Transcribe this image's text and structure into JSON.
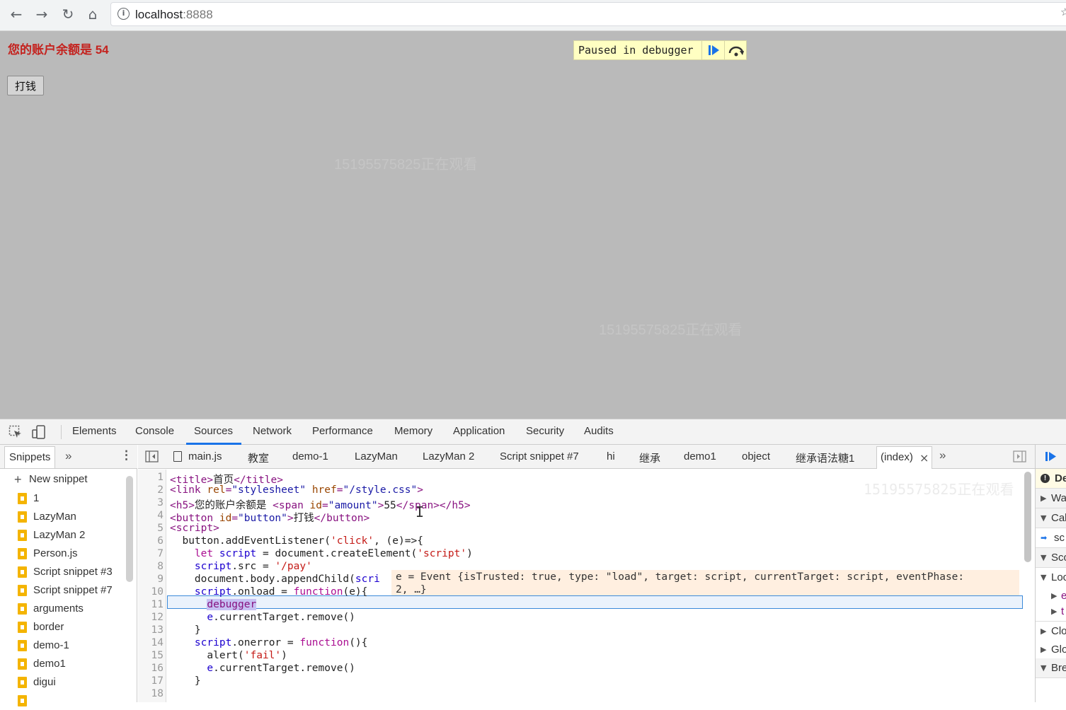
{
  "browser": {
    "url_host": "localhost",
    "url_port": ":8888"
  },
  "page": {
    "balance_text": "您的账户余额是 54",
    "pay_button": "打钱",
    "paused_text": "Paused in debugger",
    "watermark": "15195575825正在观看"
  },
  "devtools": {
    "tabs": [
      "Elements",
      "Console",
      "Sources",
      "Network",
      "Performance",
      "Memory",
      "Application",
      "Security",
      "Audits"
    ],
    "navigator": {
      "title": "Snippets",
      "new_snippet": "New snippet",
      "items": [
        "1",
        "LazyMan",
        "LazyMan 2",
        "Person.js",
        "Script snippet #3",
        "Script snippet #7",
        "arguments",
        "border",
        "demo-1",
        "demo1",
        "digui"
      ]
    },
    "editor_tabs": [
      "main.js",
      "教室",
      "demo-1",
      "LazyMan",
      "LazyMan 2",
      "Script snippet #7",
      "hi",
      "继承",
      "demo1",
      "object",
      "继承语法糖1",
      "(index)"
    ],
    "line_numbers": [
      "1",
      "2",
      "3",
      "4",
      "5",
      "6",
      "7",
      "8",
      "9",
      "10",
      "11",
      "12",
      "13",
      "14",
      "15",
      "16",
      "17",
      "18"
    ],
    "inline_value": {
      "line1": "e = Event {isTrusted: true, type: \"load\", target: script, currentTarget: script, eventPhase:",
      "line2": "2, …}"
    },
    "sidebar": [
      "De",
      "Wa",
      "Cal",
      "sc",
      "Sco",
      "Loc",
      "e",
      "t",
      "Clo",
      "Glo",
      "Bre"
    ]
  },
  "colors": {
    "balance": "#c4231f",
    "active_tab_underline": "#1a73e8",
    "paused_bg": "#ffffc2",
    "page_overlay": "#bababa"
  }
}
